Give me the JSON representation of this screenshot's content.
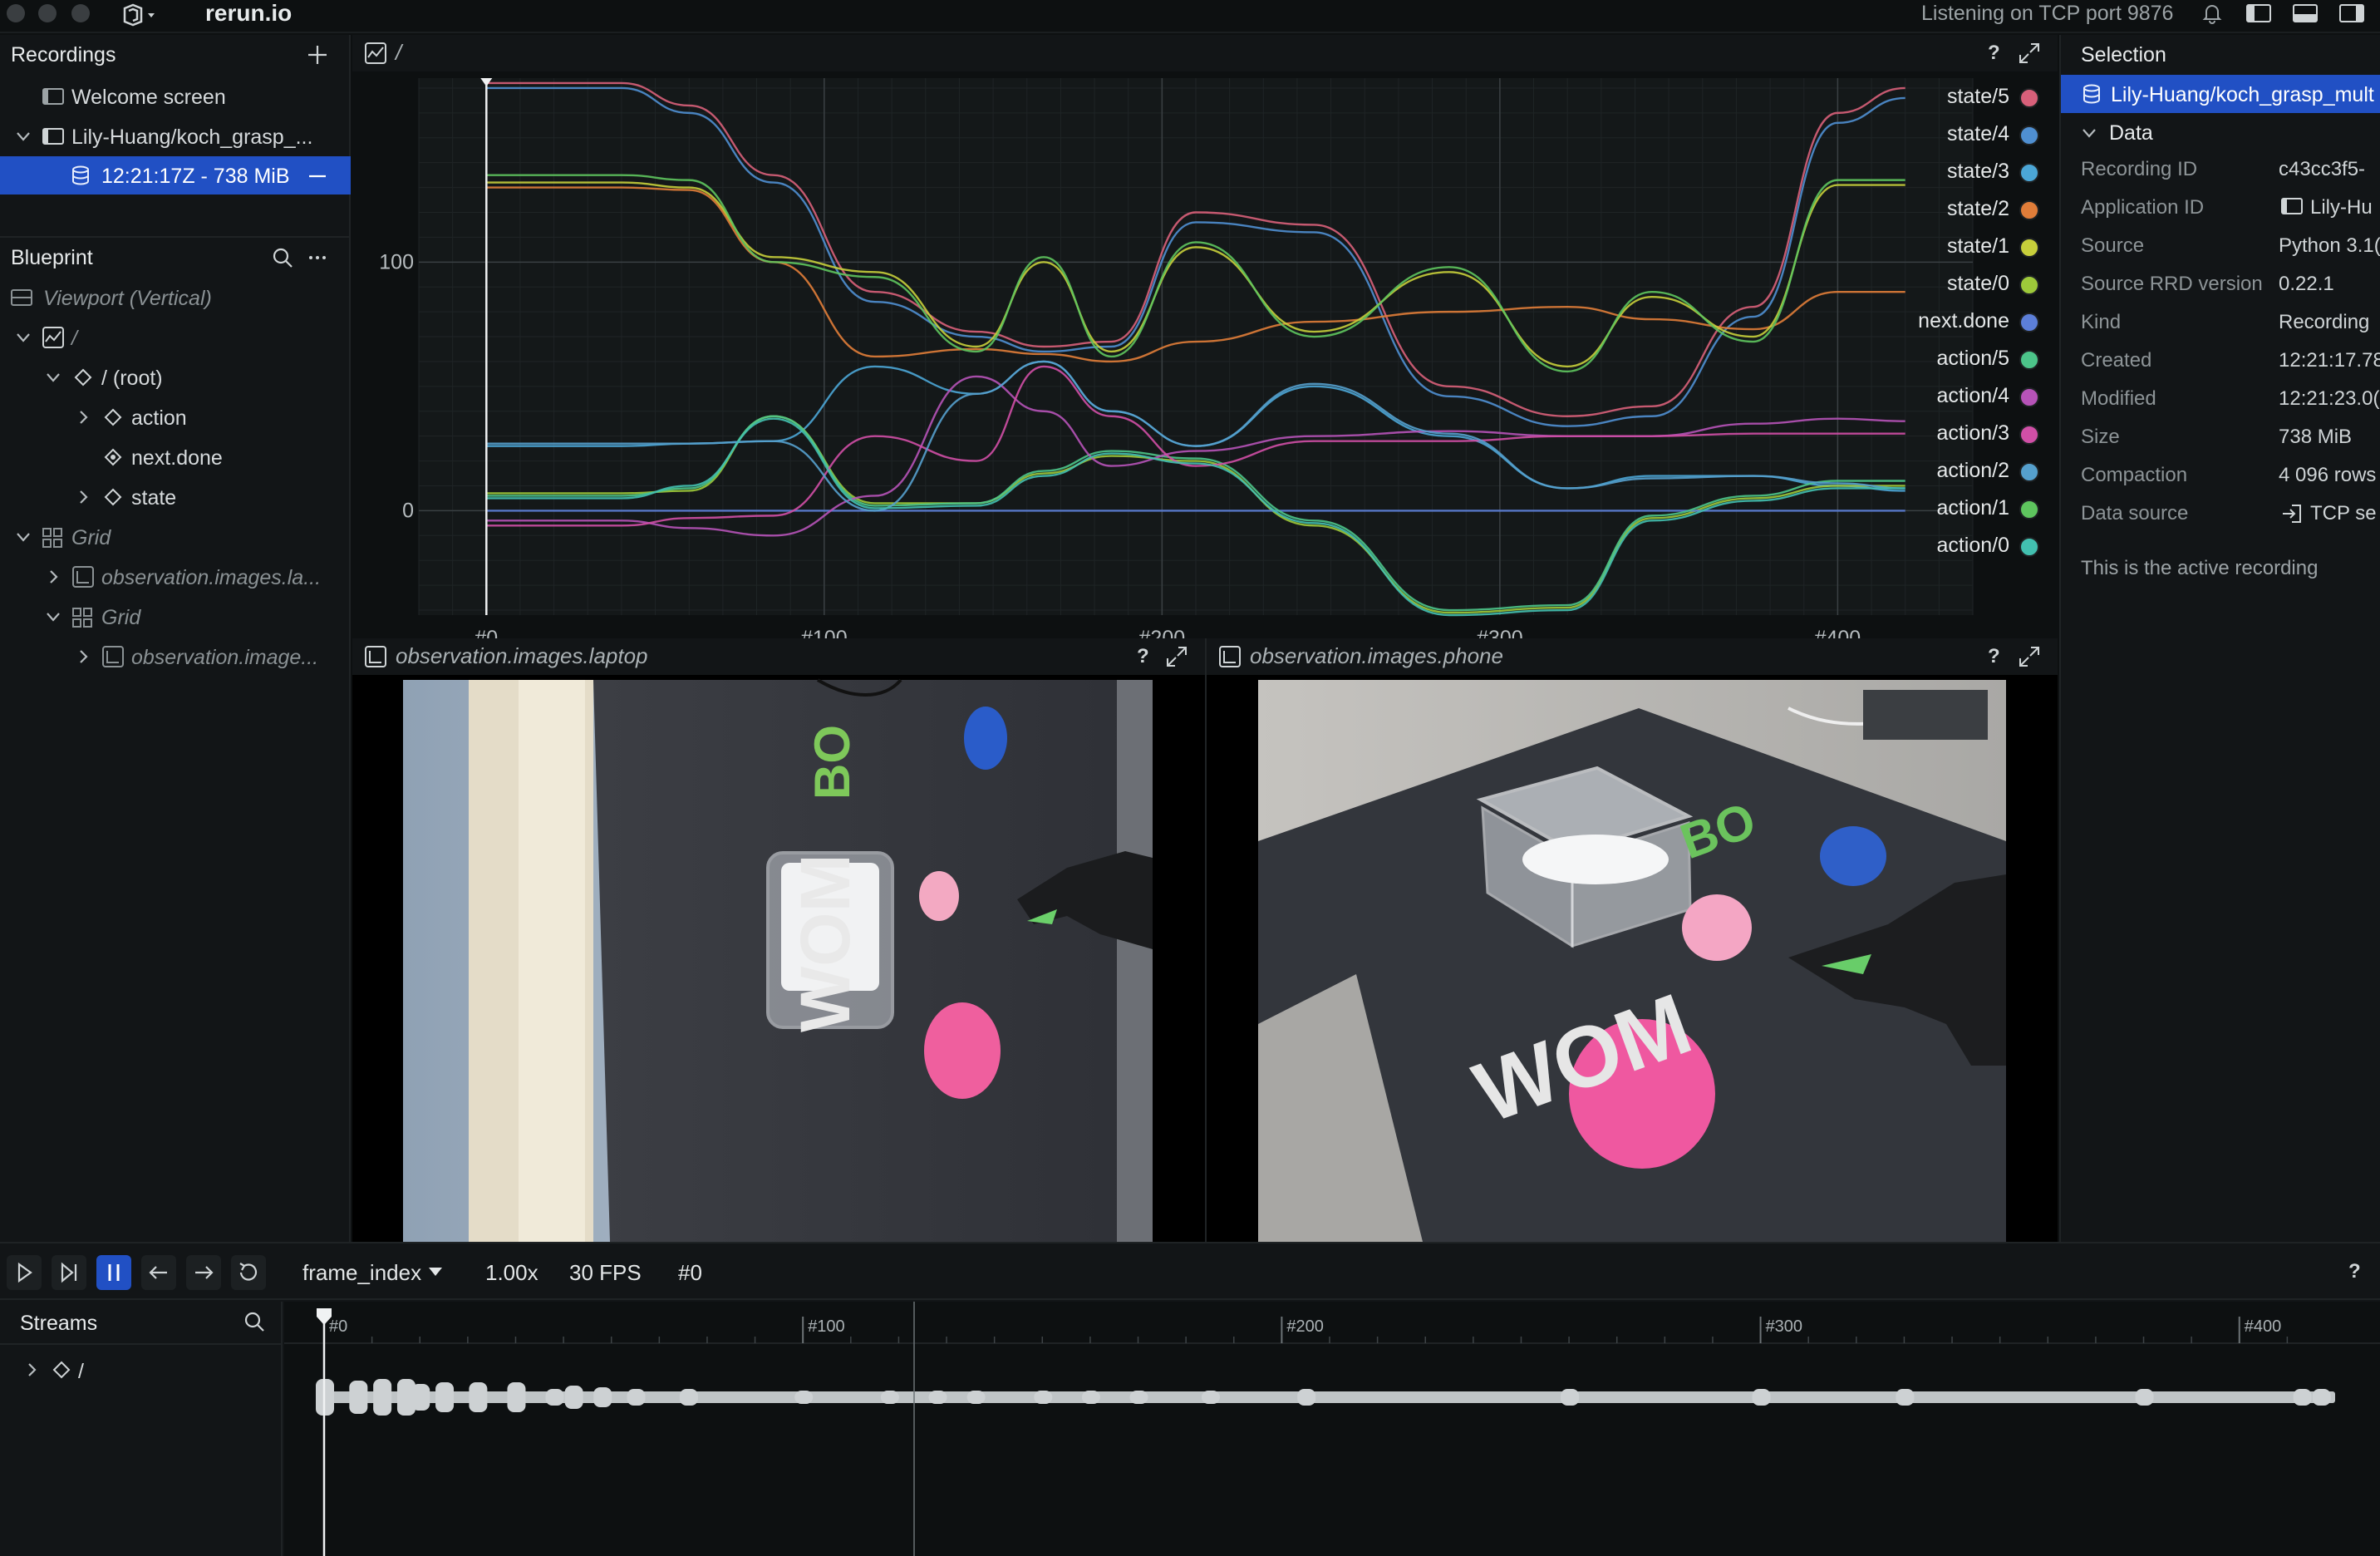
{
  "app": {
    "name": "rerun.io",
    "status": "Listening on TCP port 9876"
  },
  "left": {
    "recordings_title": "Recordings",
    "recordings": [
      {
        "label": "Welcome screen"
      },
      {
        "label": "Lily-Huang/koch_grasp_..."
      },
      {
        "label": "12:21:17Z - 738 MiB"
      }
    ],
    "blueprint_title": "Blueprint",
    "blueprint": [
      {
        "label": "Viewport (Vertical)"
      },
      {
        "label": "/"
      },
      {
        "label": "/ (root)"
      },
      {
        "label": "action"
      },
      {
        "label": "next.done"
      },
      {
        "label": "state"
      },
      {
        "label": "Grid"
      },
      {
        "label": "observation.images.la..."
      },
      {
        "label": "Grid"
      },
      {
        "label": "observation.image..."
      }
    ]
  },
  "views": {
    "plot_title": "/",
    "laptop_title": "observation.images.laptop",
    "phone_title": "observation.images.phone",
    "help": "?"
  },
  "chart_data": {
    "type": "line",
    "x_ticks": [
      "#0",
      "#100",
      "#200",
      "#300",
      "#400"
    ],
    "y_ticks": [
      "100",
      "0"
    ],
    "xlim": [
      -20,
      440
    ],
    "ylim": [
      -42,
      174
    ],
    "cursor_x": 0,
    "series": [
      {
        "name": "state/5",
        "color": "#d8607a",
        "x": [
          0,
          40,
          60,
          85,
          115,
          145,
          165,
          185,
          210,
          245,
          285,
          320,
          345,
          375,
          400,
          420
        ],
        "y": [
          172,
          172,
          163,
          135,
          88,
          72,
          66,
          68,
          120,
          115,
          50,
          38,
          42,
          82,
          160,
          170
        ]
      },
      {
        "name": "state/4",
        "color": "#4f8fd1",
        "x": [
          0,
          40,
          60,
          85,
          115,
          145,
          165,
          185,
          210,
          245,
          285,
          320,
          345,
          375,
          400,
          420
        ],
        "y": [
          170,
          170,
          160,
          132,
          84,
          70,
          64,
          66,
          116,
          112,
          46,
          34,
          38,
          78,
          156,
          166
        ]
      },
      {
        "name": "state/3",
        "color": "#4ba6d6",
        "x": [
          0,
          40,
          60,
          85,
          115,
          145,
          165,
          185,
          210,
          245,
          285,
          320,
          345,
          375,
          400,
          420
        ],
        "y": [
          26,
          26,
          27,
          28,
          58,
          47,
          60,
          40,
          26,
          50,
          30,
          9,
          14,
          14,
          10,
          8
        ]
      },
      {
        "name": "state/2",
        "color": "#e07d39",
        "x": [
          0,
          40,
          60,
          85,
          115,
          145,
          165,
          185,
          210,
          245,
          285,
          320,
          345,
          375,
          400,
          420
        ],
        "y": [
          130,
          130,
          129,
          100,
          62,
          65,
          63,
          60,
          68,
          76,
          80,
          82,
          77,
          73,
          88,
          88
        ]
      },
      {
        "name": "state/1",
        "color": "#c7cf3b",
        "x": [
          0,
          40,
          60,
          85,
          115,
          145,
          165,
          185,
          210,
          245,
          285,
          320,
          345,
          375,
          400,
          420
        ],
        "y": [
          132,
          132,
          130,
          102,
          96,
          66,
          100,
          64,
          106,
          72,
          96,
          58,
          86,
          70,
          131,
          131
        ]
      },
      {
        "name": "state/0",
        "color": "#9dc93a",
        "x": [
          0,
          40,
          60,
          85,
          115,
          145,
          165,
          185,
          210,
          245,
          285,
          320,
          345,
          375,
          400,
          420
        ],
        "y": [
          7,
          7,
          8,
          38,
          3,
          3,
          15,
          22,
          20,
          -6,
          -41,
          -39,
          -3,
          5,
          10,
          10
        ]
      },
      {
        "name": "next.done",
        "color": "#5c7fd8",
        "x": [
          0,
          420
        ],
        "y": [
          0,
          0
        ]
      },
      {
        "name": "action/5",
        "color": "#4cc58a",
        "x": [
          0,
          40,
          60,
          85,
          115,
          145,
          165,
          185,
          210,
          245,
          285,
          320,
          345,
          375,
          400,
          420
        ],
        "y": [
          6,
          6,
          9,
          38,
          2,
          3,
          16,
          24,
          21,
          -4,
          -40,
          -38,
          -2,
          6,
          12,
          12
        ]
      },
      {
        "name": "action/4",
        "color": "#b653b8",
        "x": [
          0,
          40,
          60,
          85,
          115,
          145,
          165,
          185,
          210,
          245,
          285,
          320,
          345,
          375,
          400,
          420
        ],
        "y": [
          -4,
          -4,
          -7,
          -10,
          6,
          54,
          40,
          18,
          24,
          30,
          32,
          30,
          30,
          35,
          37,
          36
        ]
      },
      {
        "name": "action/3",
        "color": "#d04fa6",
        "x": [
          0,
          40,
          60,
          85,
          115,
          145,
          165,
          185,
          210,
          245,
          285,
          320,
          345,
          375,
          400,
          420
        ],
        "y": [
          -6,
          -6,
          -3,
          -2,
          30,
          20,
          58,
          38,
          18,
          28,
          28,
          30,
          30,
          31,
          31,
          31
        ]
      },
      {
        "name": "action/2",
        "color": "#55a0cd",
        "x": [
          0,
          40,
          60,
          85,
          115,
          145,
          165,
          185,
          210,
          245,
          285,
          320,
          345,
          375,
          400,
          420
        ],
        "y": [
          27,
          27,
          27,
          28,
          0,
          47,
          60,
          40,
          26,
          51,
          31,
          9,
          13,
          14,
          11,
          9
        ]
      },
      {
        "name": "action/1",
        "color": "#5ec55e",
        "x": [
          0,
          40,
          60,
          85,
          115,
          145,
          165,
          185,
          210,
          245,
          285,
          320,
          345,
          375,
          400,
          420
        ],
        "y": [
          135,
          135,
          133,
          100,
          94,
          64,
          102,
          62,
          108,
          70,
          98,
          56,
          88,
          68,
          133,
          133
        ]
      },
      {
        "name": "action/0",
        "color": "#42c0b0",
        "x": [
          0,
          40,
          60,
          85,
          115,
          145,
          165,
          185,
          210,
          245,
          285,
          320,
          345,
          375,
          400,
          420
        ],
        "y": [
          5,
          5,
          10,
          37,
          1,
          2,
          14,
          23,
          19,
          -5,
          -42,
          -40,
          -4,
          4,
          9,
          9
        ]
      }
    ]
  },
  "selection": {
    "title": "Selection",
    "item": "Lily-Huang/koch_grasp_mult",
    "data_section": "Data",
    "fields": [
      {
        "key": "Recording ID",
        "value": "c43cc3f5-"
      },
      {
        "key": "Application ID",
        "value": "Lily-Hu"
      },
      {
        "key": "Source",
        "value": "Python 3.1("
      },
      {
        "key": "Source RRD version",
        "value": "0.22.1"
      },
      {
        "key": "Kind",
        "value": "Recording"
      },
      {
        "key": "Created",
        "value": "12:21:17.78"
      },
      {
        "key": "Modified",
        "value": "12:21:23.0("
      },
      {
        "key": "Size",
        "value": "738 MiB"
      },
      {
        "key": "Compaction",
        "value": "4 096 rows"
      },
      {
        "key": "Data source",
        "value": "TCP se"
      }
    ],
    "note": "This is the active recording"
  },
  "timeline": {
    "timeline_name": "frame_index",
    "speed": "1.00x",
    "fps": "30 FPS",
    "current": "#0",
    "streams_title": "Streams",
    "stream_root": "/",
    "ticks": [
      "#0",
      "#100",
      "#200",
      "#300",
      "#400"
    ]
  },
  "scene_text": {
    "laptop_mat": "WOM",
    "laptop_mat2": "BO",
    "phone_mat": "WOM",
    "phone_mat2": "BO"
  }
}
